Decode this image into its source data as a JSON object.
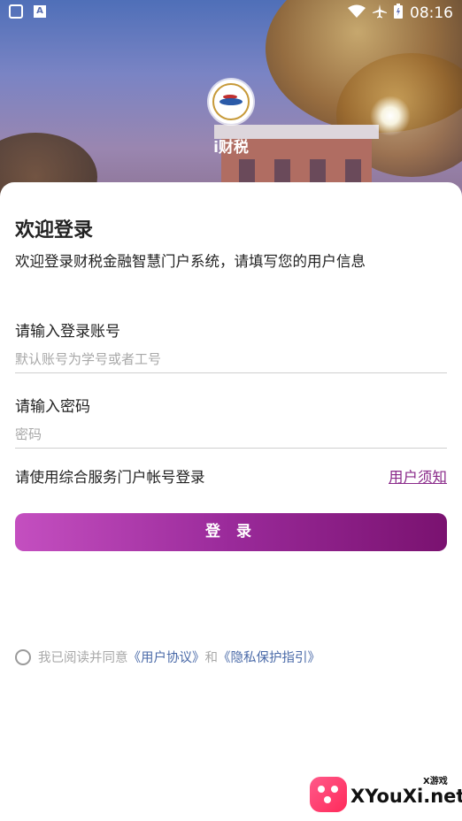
{
  "status_bar": {
    "time": "08:16",
    "notif_a": "A",
    "icons": [
      "wifi-icon",
      "airplane-icon",
      "battery-icon"
    ]
  },
  "header": {
    "app_name": "i财税"
  },
  "login": {
    "welcome_title": "欢迎登录",
    "welcome_subtitle": "欢迎登录财税金融智慧门户系统，请填写您的用户信息",
    "account_label": "请输入登录账号",
    "account_placeholder": "默认账号为学号或者工号",
    "account_value": "",
    "password_label": "请输入密码",
    "password_placeholder": "密码",
    "password_value": "",
    "hint": "请使用综合服务门户帐号登录",
    "notice_link": "用户须知",
    "login_button": "登 录"
  },
  "agreement": {
    "checked": false,
    "prefix": "我已阅读并同意",
    "user_agreement": "《用户协议》",
    "and": "和",
    "privacy_policy": "《隐私保护指引》"
  },
  "watermark": {
    "text": "XYouXi.net",
    "small": "X游戏"
  },
  "colors": {
    "accent": "#9a2a9a",
    "link": "#4a6aa8",
    "notice_link": "#8a2a8a"
  }
}
